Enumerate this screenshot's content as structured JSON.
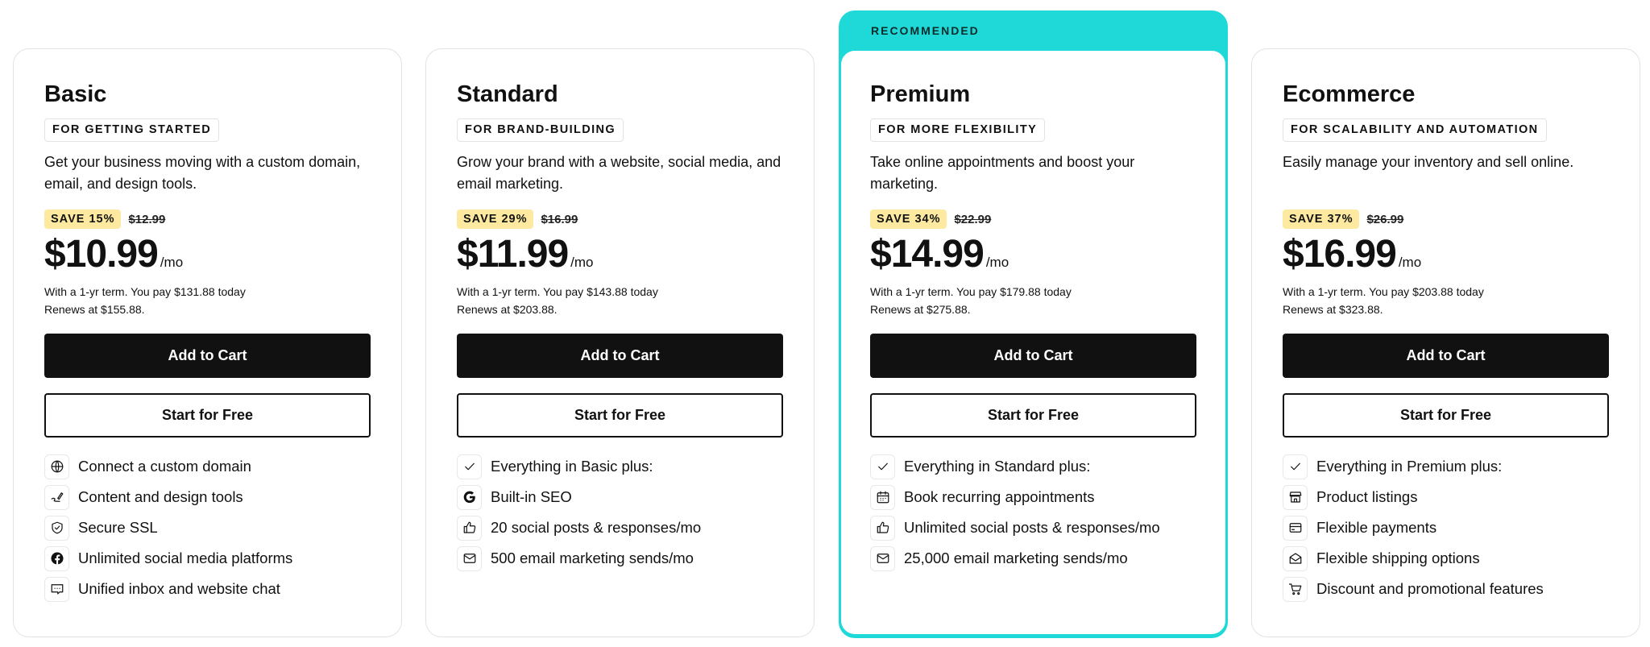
{
  "recommended_label": "RECOMMENDED",
  "accent_color": "#1fd9d9",
  "plans": [
    {
      "name": "Basic",
      "tag": "FOR GETTING STARTED",
      "description": "Get your business moving with a custom domain, email, and design tools.",
      "save": "SAVE 15%",
      "old_price": "$12.99",
      "price": "$10.99",
      "per": "/mo",
      "term1": "With a 1-yr term. You pay $131.88 today",
      "term2": "Renews at $155.88.",
      "add_to_cart": "Add to Cart",
      "start_free": "Start for Free",
      "features": [
        {
          "icon": "globe",
          "text": "Connect a custom domain"
        },
        {
          "icon": "pen",
          "text": "Content and design tools"
        },
        {
          "icon": "shield",
          "text": "Secure SSL"
        },
        {
          "icon": "facebook",
          "text": "Unlimited social media platforms"
        },
        {
          "icon": "chat",
          "text": "Unified inbox and website chat"
        }
      ]
    },
    {
      "name": "Standard",
      "tag": "FOR BRAND-BUILDING",
      "description": "Grow your brand with a website, social media, and email marketing.",
      "save": "SAVE 29%",
      "old_price": "$16.99",
      "price": "$11.99",
      "per": "/mo",
      "term1": "With a 1-yr term. You pay $143.88 today",
      "term2": "Renews at $203.88.",
      "add_to_cart": "Add to Cart",
      "start_free": "Start for Free",
      "features": [
        {
          "icon": "check",
          "text": "Everything in Basic plus:"
        },
        {
          "icon": "google",
          "text": "Built-in SEO"
        },
        {
          "icon": "thumbs-up",
          "text": "20 social posts & responses/mo"
        },
        {
          "icon": "mail",
          "text": "500 email marketing sends/mo"
        }
      ]
    },
    {
      "name": "Premium",
      "tag": "FOR MORE FLEXIBILITY",
      "description": "Take online appointments and boost your marketing.",
      "save": "SAVE 34%",
      "old_price": "$22.99",
      "price": "$14.99",
      "per": "/mo",
      "term1": "With a 1-yr term. You pay $179.88 today",
      "term2": "Renews at $275.88.",
      "add_to_cart": "Add to Cart",
      "start_free": "Start for Free",
      "features": [
        {
          "icon": "check",
          "text": "Everything in Standard plus:"
        },
        {
          "icon": "calendar",
          "text": "Book recurring appointments"
        },
        {
          "icon": "thumbs-up",
          "text": "Unlimited social posts & responses/mo"
        },
        {
          "icon": "mail",
          "text": "25,000 email marketing sends/mo"
        }
      ]
    },
    {
      "name": "Ecommerce",
      "tag": "FOR SCALABILITY AND AUTOMATION",
      "description": "Easily manage your inventory and sell online.",
      "save": "SAVE 37%",
      "old_price": "$26.99",
      "price": "$16.99",
      "per": "/mo",
      "term1": "With a 1-yr term. You pay $203.88 today",
      "term2": "Renews at $323.88.",
      "add_to_cart": "Add to Cart",
      "start_free": "Start for Free",
      "features": [
        {
          "icon": "check",
          "text": "Everything in Premium plus:"
        },
        {
          "icon": "store",
          "text": "Product listings"
        },
        {
          "icon": "card",
          "text": "Flexible payments"
        },
        {
          "icon": "envelope-open",
          "text": "Flexible shipping options"
        },
        {
          "icon": "cart",
          "text": "Discount and promotional features"
        }
      ]
    }
  ]
}
